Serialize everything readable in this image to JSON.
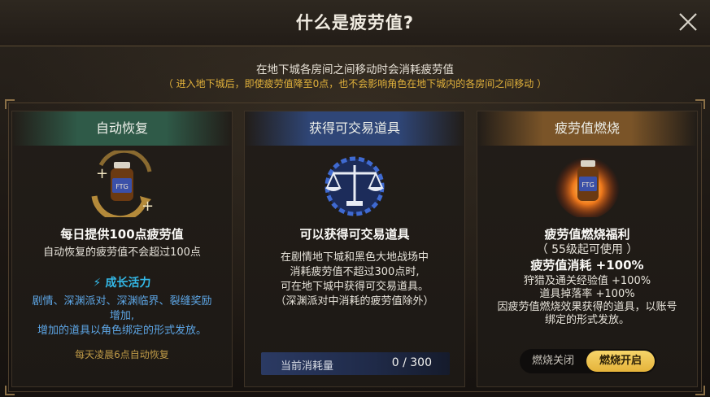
{
  "title": "什么是疲劳值?",
  "intro": {
    "line1": "在地下城各房间之间移动时会消耗疲劳值",
    "line2": "（ 进入地下城后，即使疲劳值降至0点，也不会影响角色在地下城内的各房间之间移动 ）"
  },
  "cards": {
    "auto": {
      "header": "自动恢复",
      "line1": "每日提供100点疲劳值",
      "line2": "自动恢复的疲劳值不会超过100点",
      "growth_title": "成长活力",
      "growth_l1": "剧情、深渊派对、深渊临界、裂缝奖励",
      "growth_l2": "增加,",
      "growth_l3": "增加的道具以角色绑定的形式发放。",
      "note": "每天凌晨6点自动恢复",
      "icons": [
        "potion-icon",
        "recover-arrow-icon",
        "lightning-icon"
      ]
    },
    "trade": {
      "header": "获得可交易道具",
      "line1": "可以获得可交易道具",
      "desc1": "在剧情地下城和黑色大地战场中",
      "desc2": "消耗疲劳值不超过300点时,",
      "desc3": "可在地下城中获得可交易道具。",
      "desc4": "（深渊派对中消耗的疲劳值除外）",
      "consume_label": "当前消耗量",
      "consume_value": "0 / 300",
      "icons": [
        "balance-scale-icon"
      ]
    },
    "burn": {
      "header": "疲劳值燃烧",
      "line1": "疲劳值燃烧福利",
      "line2": "（ 55级起可使用 ）",
      "line3": "疲劳值消耗 +100%",
      "line4": "狩猎及通关经验值 +100%",
      "line5": "道具掉落率 +100%",
      "line6": "因疲劳值燃烧效果获得的道具，以账号",
      "line7": "绑定的形式发放。",
      "toggle_off": "燃烧关闭",
      "toggle_on": "燃烧开启",
      "toggle_state": "on",
      "icons": [
        "burning-potion-icon"
      ]
    }
  },
  "colors": {
    "gold_accent": "#e1b13b",
    "cyan_accent": "#33b9e8",
    "blue_text": "#5da6e6",
    "toggle_on": "#f1c84f"
  }
}
